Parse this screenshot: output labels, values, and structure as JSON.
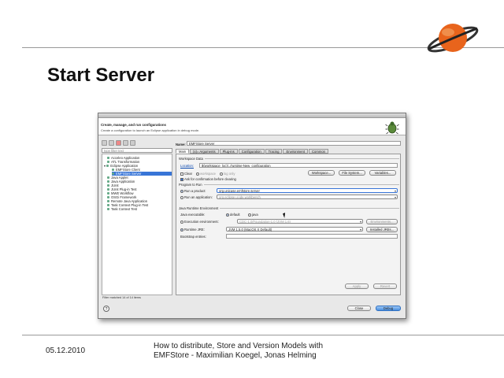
{
  "slide": {
    "title": "Start Server",
    "date": "05.12.2010",
    "footer_line1": "How to distribute, Store and Version Models with",
    "footer_line2": "EMFStore - Maximilian Koegel, Jonas Helming"
  },
  "dialog": {
    "header_title": "Create, manage, and run configurations",
    "header_subtitle": "Create a configuration to launch an Eclipse application in debug mode.",
    "filter_placeholder": "type filter text",
    "tree": [
      {
        "label": "Acceleo Application",
        "indent": 1
      },
      {
        "label": "ATL Transformation",
        "indent": 1
      },
      {
        "label": "Eclipse Application",
        "indent": 0
      },
      {
        "label": "EMFStore Client",
        "indent": 2
      },
      {
        "label": "EMFStore Server",
        "indent": 2,
        "selected": true
      },
      {
        "label": "Java Applet",
        "indent": 1
      },
      {
        "label": "Java Application",
        "indent": 1
      },
      {
        "label": "JUnit",
        "indent": 1
      },
      {
        "label": "JUnit Plug-in Test",
        "indent": 1
      },
      {
        "label": "MWE Workflow",
        "indent": 1
      },
      {
        "label": "OSGi Framework",
        "indent": 1
      },
      {
        "label": "Remote Java Application",
        "indent": 1
      },
      {
        "label": "Task Context Plug-in Test",
        "indent": 1
      },
      {
        "label": "Task Context Test",
        "indent": 1
      }
    ],
    "filter_status": "Filter matched 14 of 14 items",
    "name_label": "Name:",
    "name_value": "EMFStore Server",
    "tabs": [
      "Main",
      "(x)= Arguments",
      "Plug-ins",
      "Configuration",
      "Tracing",
      "Environment",
      "Common"
    ],
    "workspace_data": {
      "group": "Workspace Data",
      "location_label": "Location:",
      "location_value": "${workspace_loc}/../runtime-New_configuration",
      "workspace_btn": "Workspace...",
      "filesystem_btn": "File System...",
      "variables_btn": "Variables...",
      "clear_label": "Clear",
      "workspace_opt": "workspace",
      "log_only_opt": "log only",
      "ask_confirm": "Ask for confirmation before clearing"
    },
    "program_to_run": {
      "group": "Program to Run",
      "run_product_label": "Run a product:",
      "run_product_value": "org.unicase.emfstore.server",
      "run_app_label": "Run an application:",
      "run_app_value": "org.eclipse.ui.ide.workbench"
    },
    "jre": {
      "group": "Java Runtime Environment",
      "java_exec_label": "Java executable:",
      "default_opt": "default",
      "java_opt": "java",
      "exec_env_label": "Execution environment:",
      "exec_env_value": "CDC-1.0/Foundation-1.0 (JVM 1.6)",
      "environments_btn": "Environments...",
      "runtime_jre_label": "Runtime JRE:",
      "runtime_jre_value": "JVM 1.5.0 (MacOS X Default)",
      "installed_btn": "Installed JREs...",
      "bootstrap_label": "Bootstrap entries:"
    },
    "apply_btn": "Apply",
    "revert_btn": "Revert",
    "close_btn": "Close",
    "debug_btn": "Debug",
    "help_glyph": "?"
  }
}
